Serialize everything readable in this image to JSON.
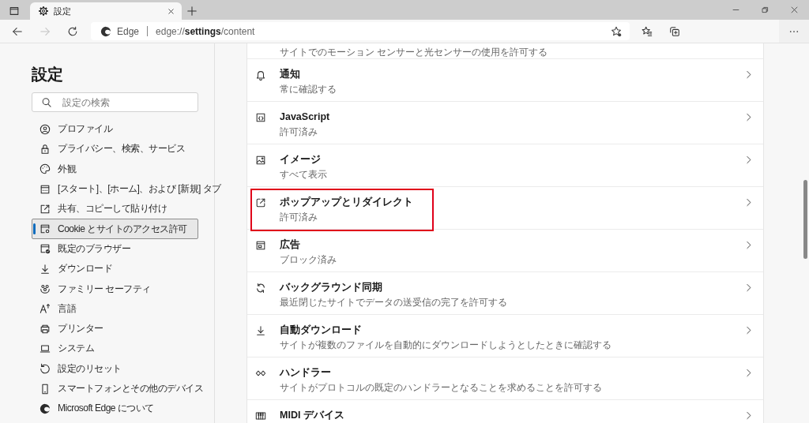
{
  "tabs": [
    {
      "title": "設定",
      "selected": true
    }
  ],
  "toolbar": {
    "nav_buttons": [
      {
        "kind": "back",
        "disabled": false
      },
      {
        "kind": "forward",
        "disabled": true
      },
      {
        "kind": "refresh",
        "disabled": false
      }
    ],
    "address_bar": {
      "site_label": "Edge",
      "url": "edge://**settings**/content"
    }
  },
  "sidebar": {
    "title": "設定",
    "search": {
      "placeholder": "設定の検索"
    },
    "items": [
      {
        "label": "プロファイル",
        "selected": false
      },
      {
        "label": "プライバシー、検索、サービス",
        "selected": false
      },
      {
        "label": "外観",
        "selected": false
      },
      {
        "label": "[スタート]、[ホーム]、および [新規] タブ",
        "selected": false
      },
      {
        "label": "共有、コピーして貼り付け",
        "selected": false
      },
      {
        "label": "Cookie とサイトのアクセス許可",
        "selected": true
      },
      {
        "label": "既定のブラウザー",
        "selected": false
      },
      {
        "label": "ダウンロード",
        "selected": false
      },
      {
        "label": "ファミリー セーフティ",
        "selected": false
      },
      {
        "label": "言語",
        "selected": false
      },
      {
        "label": "プリンター",
        "selected": false
      },
      {
        "label": "システム",
        "selected": false
      },
      {
        "label": "設定のリセット",
        "selected": false
      },
      {
        "label": "スマートフォンとその他のデバイス",
        "selected": false
      },
      {
        "label": "Microsoft Edge について",
        "selected": false
      }
    ]
  },
  "content": {
    "partial_description": "サイトでのモーション センサーと光センサーの使用を許可する",
    "items": [
      {
        "title": "通知",
        "description": "常に確認する",
        "highlighted": false
      },
      {
        "title": "JavaScript",
        "description": "許可済み",
        "highlighted": false
      },
      {
        "title": "イメージ",
        "description": "すべて表示",
        "highlighted": false
      },
      {
        "title": "ポップアップとリダイレクト",
        "description": "許可済み",
        "highlighted": true
      },
      {
        "title": "広告",
        "description": "ブロック済み",
        "highlighted": false
      },
      {
        "title": "バックグラウンド同期",
        "description": "最近閉じたサイトでデータの送受信の完了を許可する",
        "highlighted": false
      },
      {
        "title": "自動ダウンロード",
        "description": "サイトが複数のファイルを自動的にダウンロードしようとしたときに確認する",
        "highlighted": false
      },
      {
        "title": "ハンドラー",
        "description": "サイトがプロトコルの既定のハンドラーとなることを求めることを許可する",
        "highlighted": false
      },
      {
        "title": "MIDI デバイス",
        "highlighted": false
      }
    ]
  }
}
